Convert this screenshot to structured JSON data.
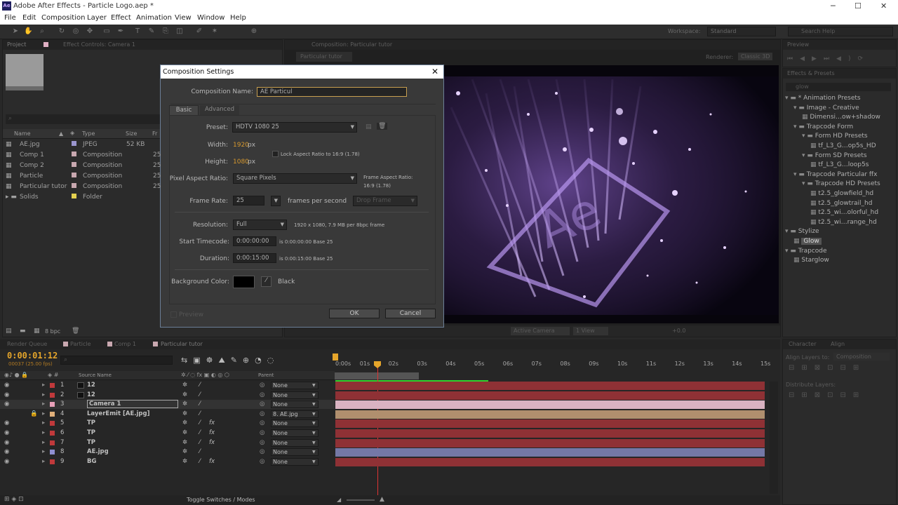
{
  "window": {
    "title": "Adobe After Effects - Particle Logo.aep *",
    "logo": "Ae",
    "min": "─",
    "max": "☐",
    "close": "✕"
  },
  "menu": [
    "File",
    "Edit",
    "Composition",
    "Layer",
    "Effect",
    "Animation",
    "View",
    "Window",
    "Help"
  ],
  "toolbar": {
    "workspace_label": "Workspace:",
    "workspace_value": "Standard",
    "search_placeholder": "Search Help"
  },
  "project": {
    "tab_project": "Project",
    "tab_effect_controls": "Effect Controls: Camera 1",
    "columns": [
      "Name",
      "Type",
      "Size",
      "Fr"
    ],
    "items": [
      {
        "name": "AE.jpg",
        "type": "JPEG",
        "size": "52 KB",
        "fr": "",
        "color": "#9b96cf"
      },
      {
        "name": "Comp 1",
        "type": "Composition",
        "size": "",
        "fr": "25",
        "color": "#c9a8b0"
      },
      {
        "name": "Comp 2",
        "type": "Composition",
        "size": "",
        "fr": "25",
        "color": "#c9a8b0"
      },
      {
        "name": "Particle",
        "type": "Composition",
        "size": "",
        "fr": "25",
        "color": "#c9a8b0"
      },
      {
        "name": "Particular tutor",
        "type": "Composition",
        "size": "",
        "fr": "25",
        "color": "#c9a8b0"
      },
      {
        "name": "Solids",
        "type": "Folder",
        "size": "",
        "fr": "",
        "color": "#e4d04f"
      }
    ],
    "bpc": "8 bpc"
  },
  "comp_viewer": {
    "tab": "Composition: Particular tutor",
    "subtab": "Particular tutor",
    "renderer": "Renderer:",
    "renderer_value": "Classic 3D",
    "bottom": {
      "camera": "Active Camera",
      "view": "1 View",
      "offset": "+0.0"
    }
  },
  "preview": {
    "tab": "Preview"
  },
  "effects": {
    "tab": "Effects & Presets",
    "search": "glow",
    "tree": [
      {
        "label": "* Animation Presets",
        "level": 0,
        "kind": "folder"
      },
      {
        "label": "Image - Creative",
        "level": 1,
        "kind": "folder"
      },
      {
        "label": "Dimensi…ow+shadow",
        "level": 2,
        "kind": "item"
      },
      {
        "label": "Trapcode Form",
        "level": 1,
        "kind": "folder"
      },
      {
        "label": "Form HD Presets",
        "level": 2,
        "kind": "folder"
      },
      {
        "label": "tf_L3_G…op5s_HD",
        "level": 3,
        "kind": "item"
      },
      {
        "label": "Form SD Presets",
        "level": 2,
        "kind": "folder"
      },
      {
        "label": "tf_L3_G…loop5s",
        "level": 3,
        "kind": "item"
      },
      {
        "label": "Trapcode Particular ffx",
        "level": 1,
        "kind": "folder"
      },
      {
        "label": "Trapcode HD Presets",
        "level": 2,
        "kind": "folder"
      },
      {
        "label": "t2.5_glowfield_hd",
        "level": 3,
        "kind": "item"
      },
      {
        "label": "t2.5_glowtrail_hd",
        "level": 3,
        "kind": "item"
      },
      {
        "label": "t2.5_wi…olorful_hd",
        "level": 3,
        "kind": "item"
      },
      {
        "label": "t2.5_wi…range_hd",
        "level": 3,
        "kind": "item"
      },
      {
        "label": "Stylize",
        "level": 0,
        "kind": "folder"
      },
      {
        "label": "Glow",
        "level": 1,
        "kind": "effect",
        "selected": true
      },
      {
        "label": "Trapcode",
        "level": 0,
        "kind": "folder"
      },
      {
        "label": "Starglow",
        "level": 1,
        "kind": "effect"
      }
    ]
  },
  "align": {
    "tab_character": "Character",
    "tab_align": "Align",
    "align_to_label": "Align Layers to:",
    "align_to_value": "Composition",
    "distribute": "Distribute Layers:"
  },
  "dialog": {
    "title": "Composition Settings",
    "comp_name_label": "Composition Name:",
    "comp_name": "AE Particul",
    "tab_basic": "Basic",
    "tab_advanced": "Advanced",
    "preset_label": "Preset:",
    "preset": "HDTV 1080 25",
    "width_label": "Width:",
    "width": "1920",
    "height_label": "Height:",
    "height": "1080",
    "px": "px",
    "lock_aspect": "Lock Aspect Ratio to 16:9 (1.78)",
    "par_label": "Pixel Aspect Ratio:",
    "par": "Square Pixels",
    "far_label": "Frame Aspect Ratio:",
    "far_value": "16:9 (1.78)",
    "fps_label": "Frame Rate:",
    "fps": "25",
    "fps_unit": "frames per second",
    "drop_frame": "Drop Frame",
    "res_label": "Resolution:",
    "res": "Full",
    "res_info": "1920 x 1080, 7.9 MB per 8bpc frame",
    "start_label": "Start Timecode:",
    "start": "0:00:00:00",
    "start_info": "is 0:00:00:00  Base 25",
    "dur_label": "Duration:",
    "dur": "0:00:15:00",
    "dur_info": "is 0:00:15:00  Base 25",
    "bg_label": "Background Color:",
    "bg_name": "Black",
    "bg_color": "#000000",
    "preview": "Preview",
    "ok": "OK",
    "cancel": "Cancel"
  },
  "timeline": {
    "tabs": [
      "Render Queue",
      "Particle",
      "Comp 1",
      "Particular tutor"
    ],
    "timecode": "0:00:01:12",
    "frames": "00037 (25.00 fps)",
    "source_name_col": "Source Name",
    "parent_col": "Parent",
    "toggle": "Toggle Switches / Modes",
    "ruler": [
      "0:00s",
      "01s",
      "02s",
      "03s",
      "04s",
      "05s",
      "06s",
      "07s",
      "08s",
      "09s",
      "10s",
      "11s",
      "12s",
      "13s",
      "14s",
      "15s"
    ],
    "layers": [
      {
        "num": "1",
        "name": "12",
        "parent": "None",
        "color": "#c0393b",
        "bar": "#8f3135",
        "fx": false
      },
      {
        "num": "2",
        "name": "12",
        "parent": "None",
        "color": "#c0393b",
        "bar": "#8f3135",
        "fx": false
      },
      {
        "num": "3",
        "name": "Camera 1",
        "parent": "None",
        "color": "#e8a0b8",
        "bar": "#d9b3c2",
        "fx": false
      },
      {
        "num": "4",
        "name": "LayerEmit [AE.jpg]",
        "parent": "8. AE.jpg",
        "color": "#e0b07a",
        "bar": "#b08f6e",
        "fx": false
      },
      {
        "num": "5",
        "name": "TP",
        "parent": "None",
        "color": "#c0393b",
        "bar": "#8f3135",
        "fx": true
      },
      {
        "num": "6",
        "name": "TP",
        "parent": "None",
        "color": "#c0393b",
        "bar": "#8f3135",
        "fx": true
      },
      {
        "num": "7",
        "name": "TP",
        "parent": "None",
        "color": "#c0393b",
        "bar": "#8f3135",
        "fx": true
      },
      {
        "num": "8",
        "name": "AE.jpg",
        "parent": "None",
        "color": "#8f8fd0",
        "bar": "#7478a6",
        "fx": false
      },
      {
        "num": "9",
        "name": "BG",
        "parent": "None",
        "color": "#c0393b",
        "bar": "#8f3135",
        "fx": true
      }
    ]
  }
}
